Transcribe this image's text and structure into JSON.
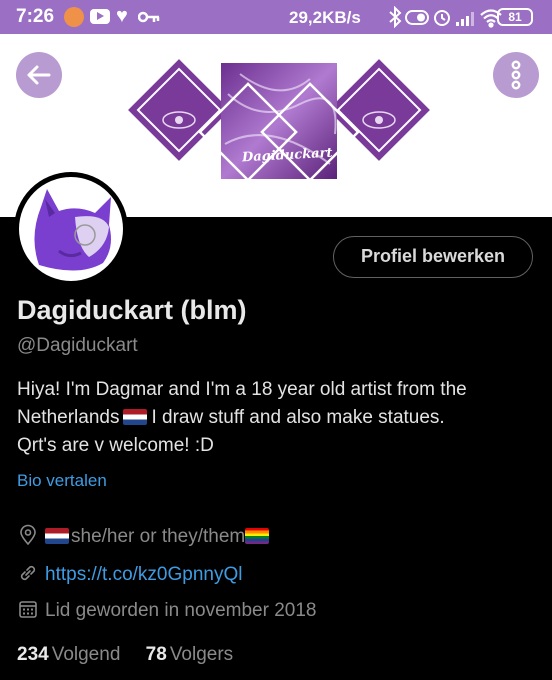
{
  "status_bar": {
    "time": "7:26",
    "speed": "29,2KB/s",
    "battery": "81",
    "color": "#9a6fc4"
  },
  "banner": {
    "text": "Dagiduckart"
  },
  "nav": {
    "back_icon": "arrow-left-icon",
    "more_icon": "more-vertical-icon"
  },
  "profile": {
    "edit_label": "Profiel bewerken",
    "name": "Dagiduckart (blm)",
    "handle": "@Dagiduckart",
    "bio_line1": "Hiya! I'm Dagmar and I'm a 18 year old artist from the",
    "bio_line2a": "Netherlands",
    "bio_line2b": "I draw stuff and also make statues.",
    "bio_line3": "Qrt's are v welcome! :D",
    "translate_label": "Bio vertalen",
    "location": "she/her or they/them",
    "link": "https://t.co/kz0GpnnyQl",
    "joined": "Lid geworden in november 2018"
  },
  "stats": {
    "following_count": "234",
    "following_label": "Volgend",
    "followers_count": "78",
    "followers_label": "Volgers"
  },
  "colors": {
    "link": "#3f9ce3",
    "accent_purple": "#9a6fc4"
  }
}
